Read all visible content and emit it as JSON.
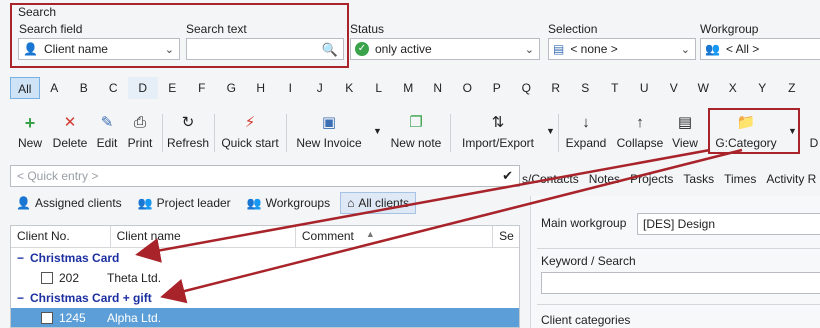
{
  "search": {
    "group_label": "Search",
    "field_label": "Search field",
    "field_value": "Client name",
    "text_label": "Search text",
    "text_value": ""
  },
  "status": {
    "label": "Status",
    "value": "only active"
  },
  "selection": {
    "label": "Selection",
    "value": "< none >"
  },
  "workgroup": {
    "label": "Workgroup",
    "value": "< All >"
  },
  "alphabet": [
    "All",
    "A",
    "B",
    "C",
    "D",
    "E",
    "F",
    "G",
    "H",
    "I",
    "J",
    "K",
    "L",
    "M",
    "N",
    "O",
    "P",
    "Q",
    "R",
    "S",
    "T",
    "U",
    "V",
    "W",
    "X",
    "Y",
    "Z"
  ],
  "toolbar": {
    "new": "New",
    "delete": "Delete",
    "edit": "Edit",
    "print": "Print",
    "refresh": "Refresh",
    "quick_start": "Quick start",
    "new_invoice": "New Invoice",
    "new_note": "New note",
    "import_export": "Import/Export",
    "expand": "Expand",
    "collapse": "Collapse",
    "view": "View",
    "category": "G:Category",
    "cut_label": "D"
  },
  "quick_entry": {
    "placeholder": "< Quick entry >"
  },
  "filter_tabs": {
    "assigned": "Assigned clients",
    "project_leader": "Project leader",
    "workgroups": "Workgroups",
    "all": "All clients"
  },
  "grid": {
    "headers": [
      "Client No.",
      "Client name",
      "Comment",
      "Se"
    ],
    "group1": "Christmas Card",
    "row1": {
      "no": "202",
      "name": "Theta Ltd."
    },
    "group2": "Christmas Card + gift",
    "row2": {
      "no": "1245",
      "name": "Alpha Ltd."
    }
  },
  "right_tabs": [
    "s/Contacts",
    "Notes",
    "Projects",
    "Tasks",
    "Times",
    "Activity R"
  ],
  "details": {
    "main_workgroup_label": "Main workgroup",
    "main_workgroup_value": "[DES] Design",
    "keyword_label": "Keyword / Search",
    "categories_label": "Client categories"
  },
  "colors": {
    "highlight_red": "#a8232a",
    "group_blue": "#1c2fa0",
    "selection_blue": "#5c9fd8"
  }
}
